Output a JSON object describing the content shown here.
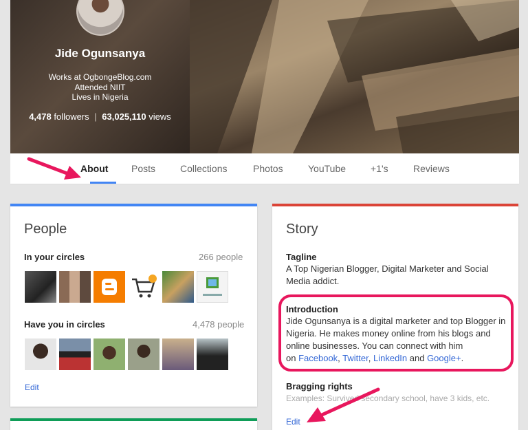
{
  "profile": {
    "name": "Jide Ogunsanya",
    "works": "Works at OgbongeBlog.com",
    "education": "Attended NIIT",
    "location": "Lives in Nigeria",
    "followers_count": "4,478",
    "followers_label": "followers",
    "views_count": "63,025,110",
    "views_label": "views",
    "separator": "|"
  },
  "tabs": [
    "About",
    "Posts",
    "Collections",
    "Photos",
    "YouTube",
    "+1's",
    "Reviews"
  ],
  "people": {
    "title": "People",
    "in_circles_label": "In your circles",
    "in_circles_count": "266 people",
    "have_you_label": "Have you in circles",
    "have_you_count": "4,478 people",
    "edit": "Edit"
  },
  "story": {
    "title": "Story",
    "tagline_label": "Tagline",
    "tagline_line1": "A Top Nigerian Blogger, Digital Marketer and Social",
    "tagline_line2": "Media addict.",
    "intro_label": "Introduction",
    "intro_line1": "Jide Ogunsanya is a digital marketer and top Blogger in",
    "intro_line2": "Nigeria. He makes money online from his blogs and",
    "intro_line3": "online businesses. You can connect with him",
    "intro_on": "on ",
    "link_facebook": "Facebook",
    "link_twitter": "Twitter",
    "link_linkedin": "LinkedIn",
    "intro_and": " and ",
    "link_googleplus": "Google+",
    "comma": ", ",
    "period": ".",
    "bragging_label": "Bragging rights",
    "bragging_placeholder": "Examples: Survived secondary school, have 3 kids, etc.",
    "edit": "Edit"
  },
  "colors": {
    "people_bar": "#4285f4",
    "story_bar": "#db4437",
    "bottom_bar": "#0f9d58",
    "highlight": "#e8175d",
    "link": "#3367d6"
  }
}
